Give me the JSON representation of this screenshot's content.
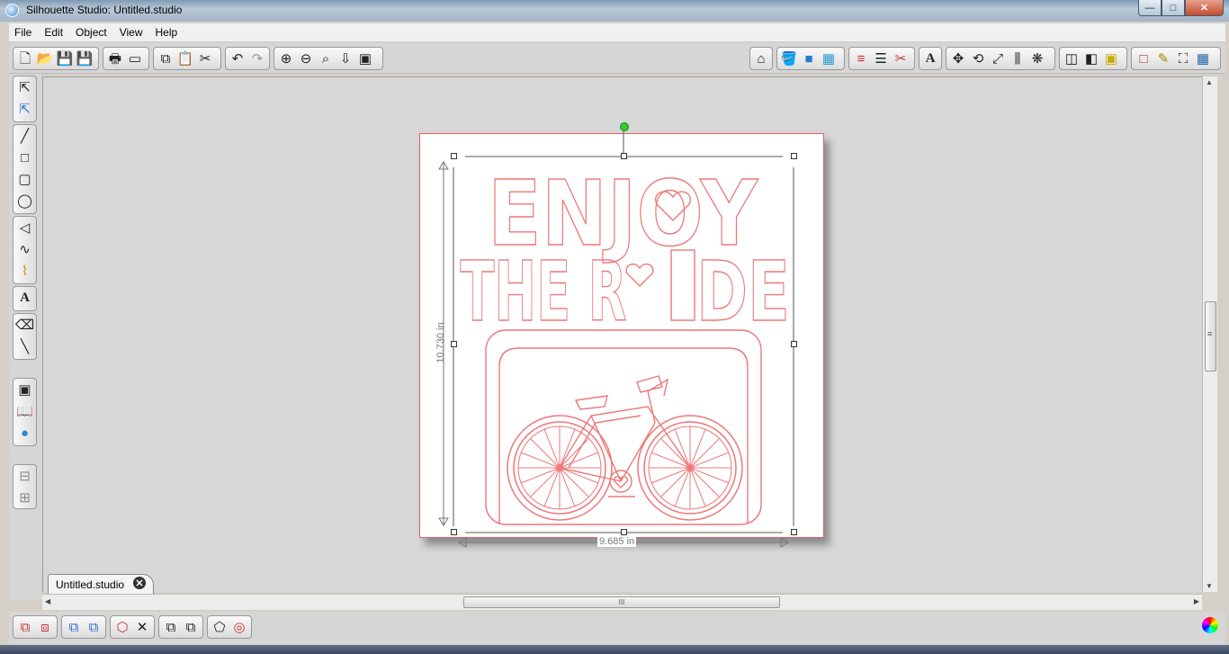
{
  "window": {
    "title": "Silhouette Studio: Untitled.studio",
    "min": "—",
    "max": "□",
    "close": "✕"
  },
  "menu": [
    "File",
    "Edit",
    "Object",
    "View",
    "Help"
  ],
  "document": {
    "tab": "Untitled.studio",
    "tab_close": "✕"
  },
  "design": {
    "line1": "ENJOY",
    "line2a": "THE R",
    "line2b": "DE"
  },
  "dimensions": {
    "height": "10.730 in",
    "width": "9.685 in"
  },
  "scroll": {
    "grip": "III",
    "grip_v": "≡"
  },
  "colors": {
    "cut_line": "#ee7777",
    "page_border": "#e06060",
    "canvas": "#d7d7d7"
  },
  "icons": {
    "file": [
      "new-icon",
      "open-icon",
      "save-icon",
      "save-library-icon"
    ],
    "print": [
      "print-icon",
      "send-to-cutter-icon"
    ],
    "clipboard": [
      "copy-icon",
      "paste-icon",
      "cut-icon"
    ],
    "history": [
      "undo-icon",
      "redo-icon"
    ],
    "zoom": [
      "zoom-in-icon",
      "zoom-out-icon",
      "zoom-select-icon",
      "pan-icon",
      "fit-page-icon"
    ]
  }
}
